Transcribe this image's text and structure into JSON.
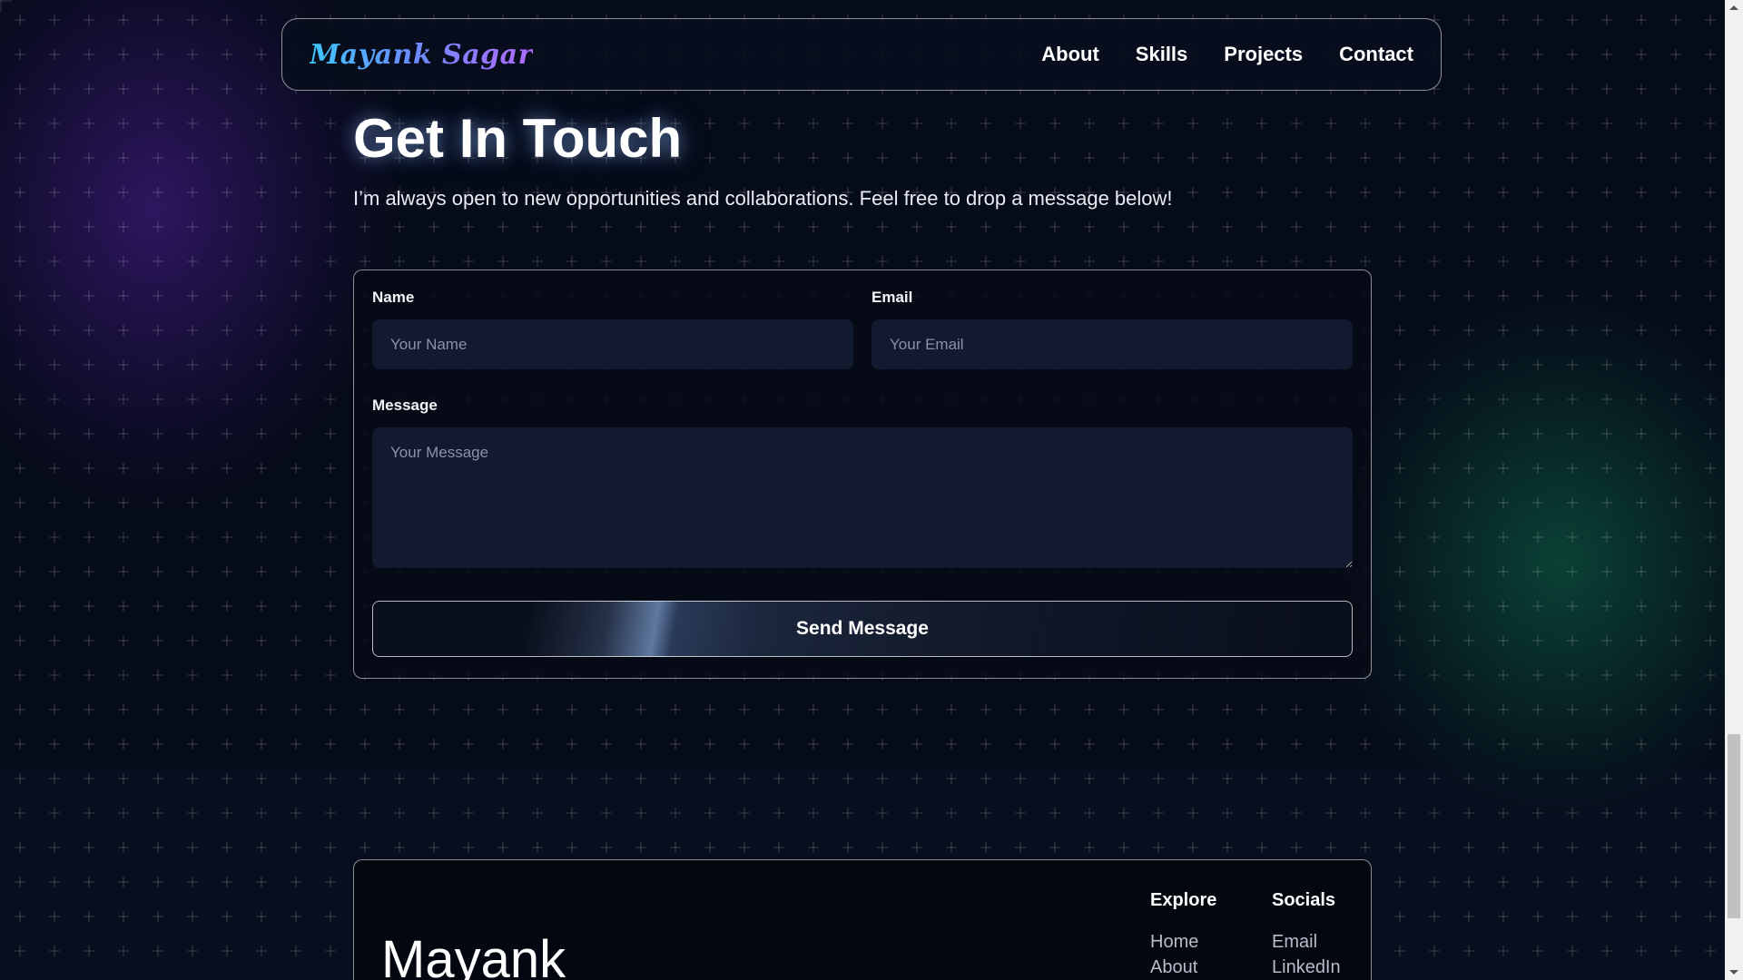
{
  "navbar": {
    "logo": "Mayank Sagar",
    "links": [
      "About",
      "Skills",
      "Projects",
      "Contact"
    ]
  },
  "contact": {
    "title": "Get In Touch",
    "subtitle": "I’m always open to new opportunities and collaborations. Feel free to drop a message below!",
    "name_label": "Name",
    "name_placeholder": "Your Name",
    "email_label": "Email",
    "email_placeholder": "Your Email",
    "message_label": "Message",
    "message_placeholder": "Your Message",
    "submit_label": "Send Message"
  },
  "footer": {
    "name": "Mayank",
    "explore_heading": "Explore",
    "explore_links": [
      "Home",
      "About"
    ],
    "socials_heading": "Socials",
    "socials_links": [
      "Email",
      "LinkedIn"
    ]
  },
  "colors": {
    "background": "#060b18",
    "field_background": "#111a2e",
    "logo_gradient_start": "#3ec8ff",
    "logo_gradient_end": "#b06aff",
    "glow_purple": "#6e28d2",
    "glow_green": "#14be78"
  },
  "icons": {
    "scroll_up": "scroll-up-arrow-icon",
    "scroll_down": "scroll-down-arrow-icon"
  }
}
